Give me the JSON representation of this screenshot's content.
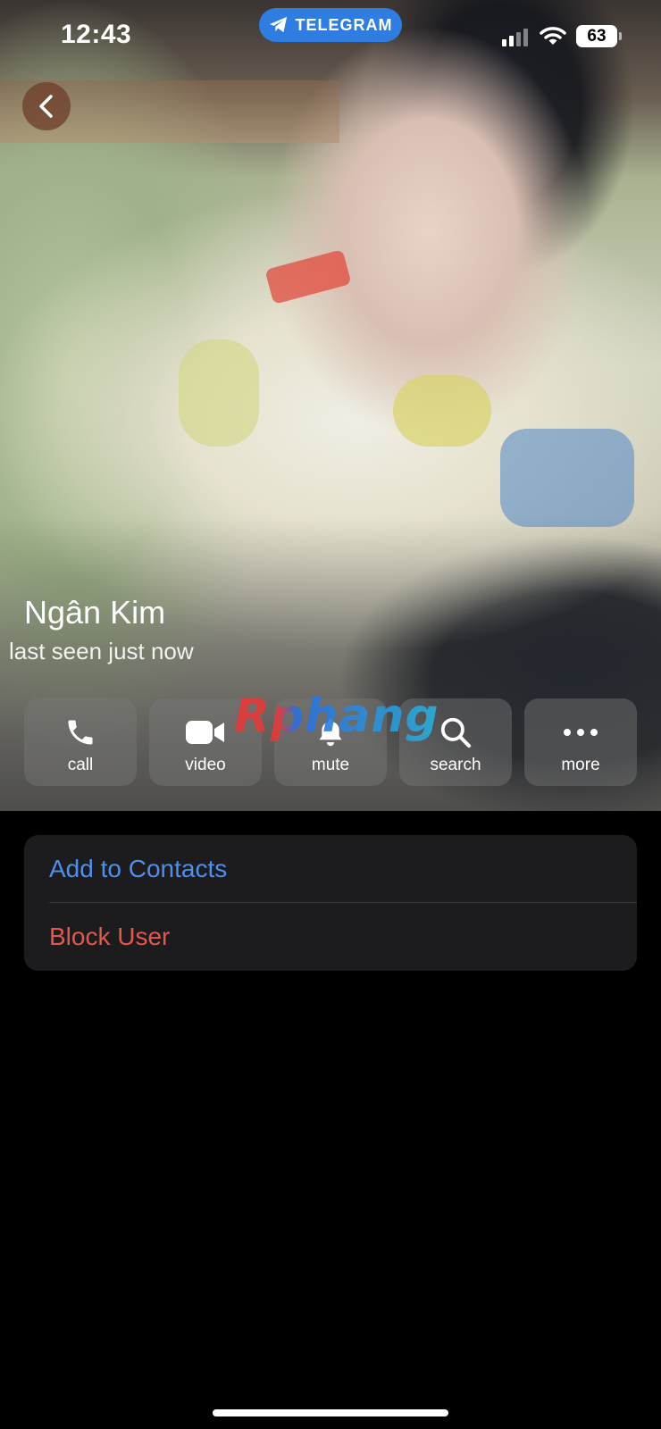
{
  "status_bar": {
    "time": "12:43",
    "app_pill": "TELEGRAM",
    "battery": "63"
  },
  "profile": {
    "name": "Ngân Kim",
    "status": "last seen just now"
  },
  "actions": [
    {
      "label": "call",
      "icon": "phone-icon"
    },
    {
      "label": "video",
      "icon": "video-camera-icon"
    },
    {
      "label": "mute",
      "icon": "bell-icon"
    },
    {
      "label": "search",
      "icon": "search-icon"
    },
    {
      "label": "more",
      "icon": "more-dots-icon"
    }
  ],
  "watermark": "Rphang",
  "options": {
    "add_contact": "Add to Contacts",
    "block_user": "Block User"
  },
  "colors": {
    "accent_blue": "#4e8fee",
    "destructive_red": "#e5574a",
    "pill_blue": "#2f7de1",
    "card_bg": "#1c1c1e"
  }
}
